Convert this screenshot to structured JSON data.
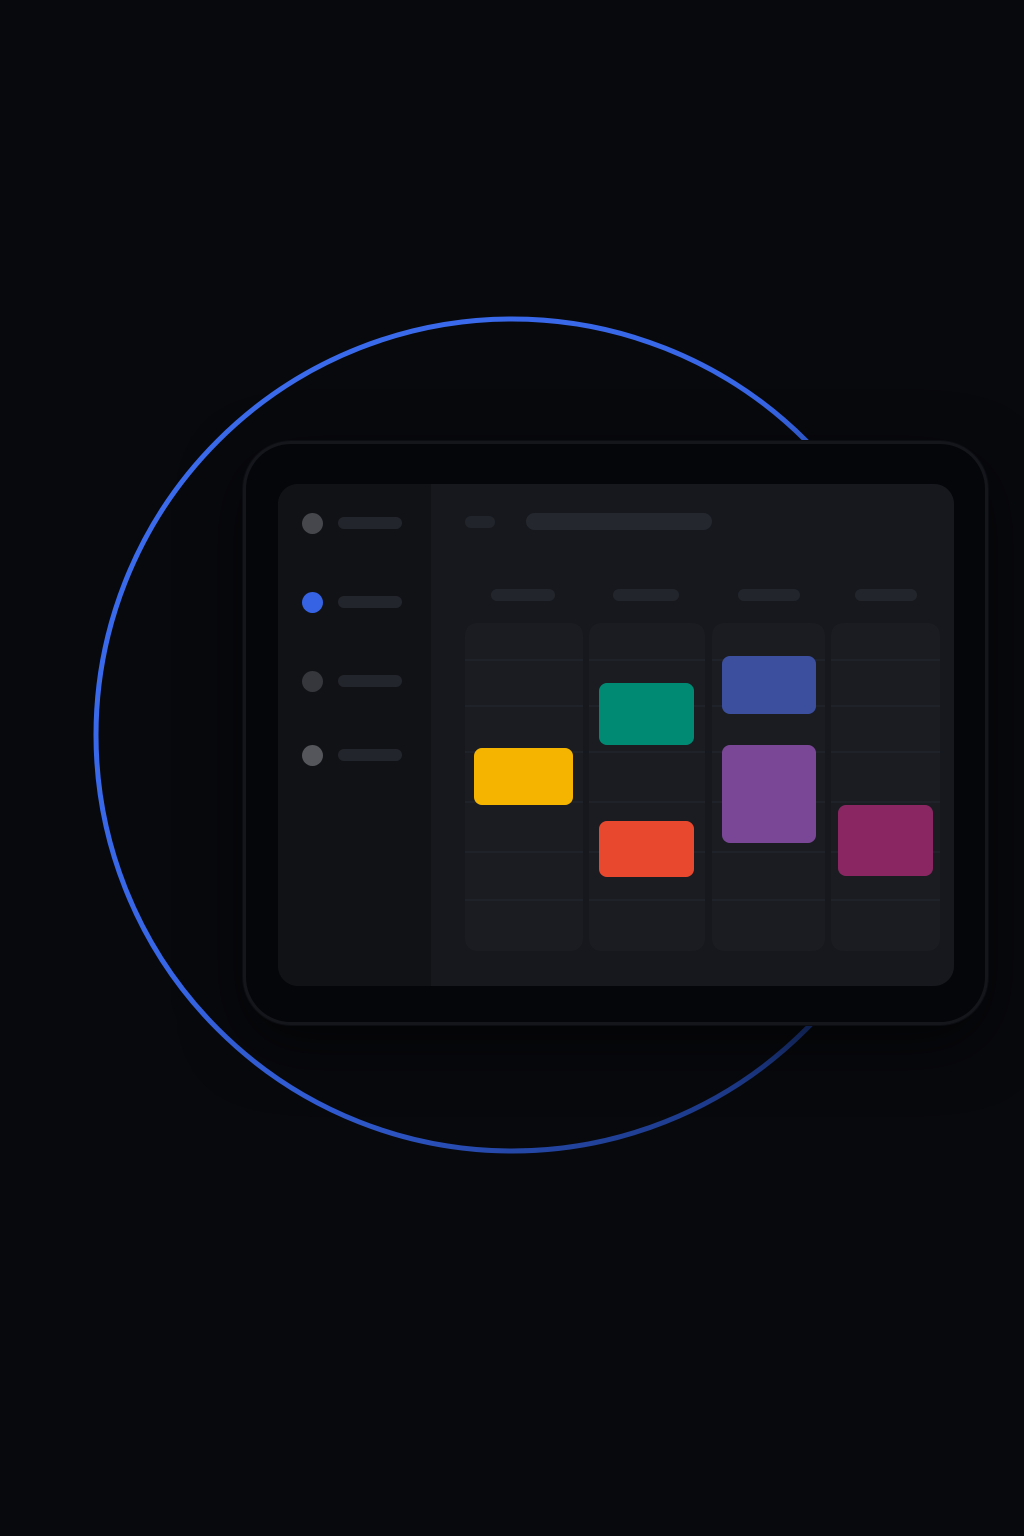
{
  "app": {
    "accent_color": "#3563e3",
    "background_color": "#08090d"
  },
  "sidebar": {
    "items": [
      {
        "icon": "dot-icon",
        "label": "",
        "active": false
      },
      {
        "icon": "dot-icon",
        "label": "",
        "active": true
      },
      {
        "icon": "dot-icon",
        "label": "",
        "active": false
      },
      {
        "icon": "dot-icon",
        "label": "",
        "active": false
      }
    ]
  },
  "header": {
    "title": ""
  },
  "calendar": {
    "columns": [
      {
        "label": ""
      },
      {
        "label": ""
      },
      {
        "label": ""
      },
      {
        "label": ""
      }
    ],
    "events": [
      {
        "column": 1,
        "color": "#f5b400",
        "label": ""
      },
      {
        "column": 2,
        "color": "#008a74",
        "label": ""
      },
      {
        "column": 2,
        "color": "#e8482e",
        "label": ""
      },
      {
        "column": 3,
        "color": "#3b4f9e",
        "label": ""
      },
      {
        "column": 3,
        "color": "#7a4796",
        "label": ""
      },
      {
        "column": 4,
        "color": "#8a2762",
        "label": ""
      }
    ]
  }
}
